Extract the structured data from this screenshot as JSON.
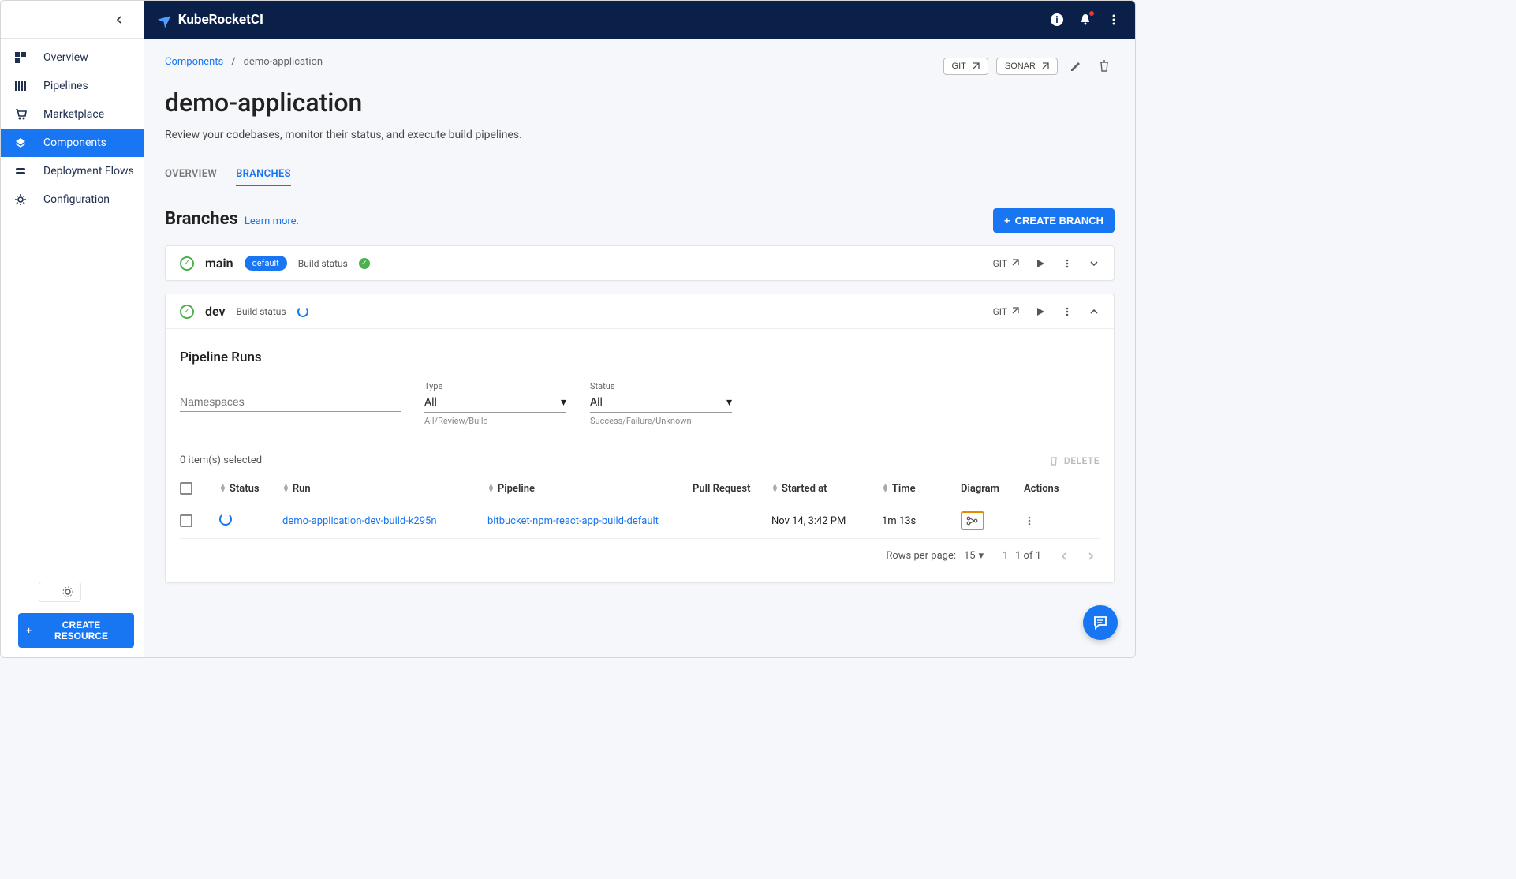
{
  "app": {
    "name": "KubeRocketCI"
  },
  "sidebar": {
    "items": [
      {
        "label": "Overview"
      },
      {
        "label": "Pipelines"
      },
      {
        "label": "Marketplace"
      },
      {
        "label": "Components"
      },
      {
        "label": "Deployment Flows"
      },
      {
        "label": "Configuration"
      }
    ],
    "create_resource": "CREATE RESOURCE"
  },
  "breadcrumb": {
    "root": "Components",
    "current": "demo-application"
  },
  "header_buttons": {
    "git": "GIT",
    "sonar": "SONAR"
  },
  "page": {
    "title": "demo-application",
    "description": "Review your codebases, monitor their status, and execute build pipelines."
  },
  "tabs": {
    "overview": "OVERVIEW",
    "branches": "BRANCHES"
  },
  "branches_section": {
    "title": "Branches",
    "learn_more": "Learn more.",
    "create_btn": "CREATE BRANCH",
    "items": [
      {
        "name": "main",
        "default_badge": "default",
        "build_status_label": "Build status",
        "git": "GIT"
      },
      {
        "name": "dev",
        "build_status_label": "Build status",
        "git": "GIT"
      }
    ]
  },
  "pipeline_runs": {
    "title": "Pipeline Runs",
    "filters": {
      "namespaces_label": "Namespaces",
      "type_label": "Type",
      "type_value": "All",
      "type_help": "All/Review/Build",
      "status_label": "Status",
      "status_value": "All",
      "status_help": "Success/Failure/Unknown"
    },
    "selected": "0 item(s) selected",
    "delete": "DELETE",
    "columns": {
      "status": "Status",
      "run": "Run",
      "pipeline": "Pipeline",
      "pull_request": "Pull Request",
      "started_at": "Started at",
      "time": "Time",
      "diagram": "Diagram",
      "actions": "Actions"
    },
    "rows": [
      {
        "run": "demo-application-dev-build-k295n",
        "pipeline": "bitbucket-npm-react-app-build-default",
        "pull_request": "",
        "started_at": "Nov 14, 3:42 PM",
        "time": "1m 13s"
      }
    ],
    "pagination": {
      "rows_per_page_label": "Rows per page:",
      "rows_per_page": "15",
      "range": "1–1 of 1"
    }
  }
}
